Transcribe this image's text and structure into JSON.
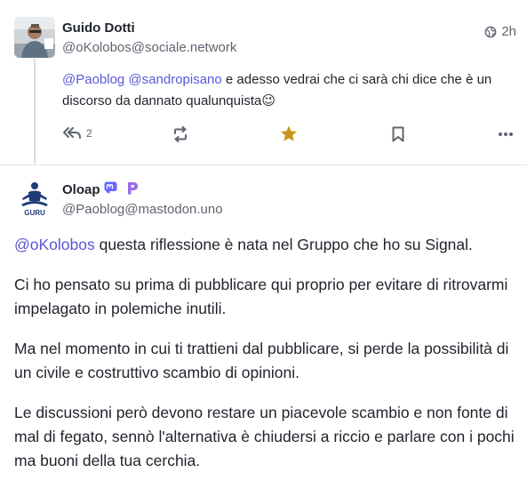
{
  "post1": {
    "author_name": "Guido Dotti",
    "author_handle": "@oKolobos@sociale.network",
    "time": "2h",
    "mention1": "@Paoblog",
    "mention2": "@sandropisano",
    "text": " e adesso vedrai che ci sarà chi dice che è un discorso da dannato qualunquista",
    "emoji": "😉",
    "reply_count": "2",
    "icons": {
      "globe": "globe-icon",
      "reply": "reply-all-icon",
      "boost": "boost-icon",
      "favourite": "star-icon",
      "bookmark": "bookmark-icon",
      "more": "more-icon"
    },
    "favourite_color": "#c8961e"
  },
  "post2": {
    "author_name": "Oloap",
    "author_handle": "@Paoblog@mastodon.uno",
    "avatar_text": "GURU",
    "mention": "@oKolobos",
    "p1_rest": " questa riflessione è nata nel Gruppo che ho su Signal.",
    "p2": "Ci ho pensato su prima di pubblicare qui proprio per evitare di ritrovarmi impelagato in polemiche inutili.",
    "p3": "Ma nel momento in cui ti trattieni dal pubblicare, si perde la possibilità di un civile e costruttivo scambio di opinioni.",
    "p4": "Le discussioni però devono restare un piacevole scambio e non fonte di mal di fegato, sennò l'alternativa è chiudersi a riccio e parlare con i pochi ma buoni della tua cerchia.",
    "badges": [
      "mastodon-icon",
      "pixelfed-icon"
    ]
  },
  "colors": {
    "accent": "#5b57d9",
    "mastodon": "#6364ff",
    "pixelfed": "#9b6ce6"
  }
}
